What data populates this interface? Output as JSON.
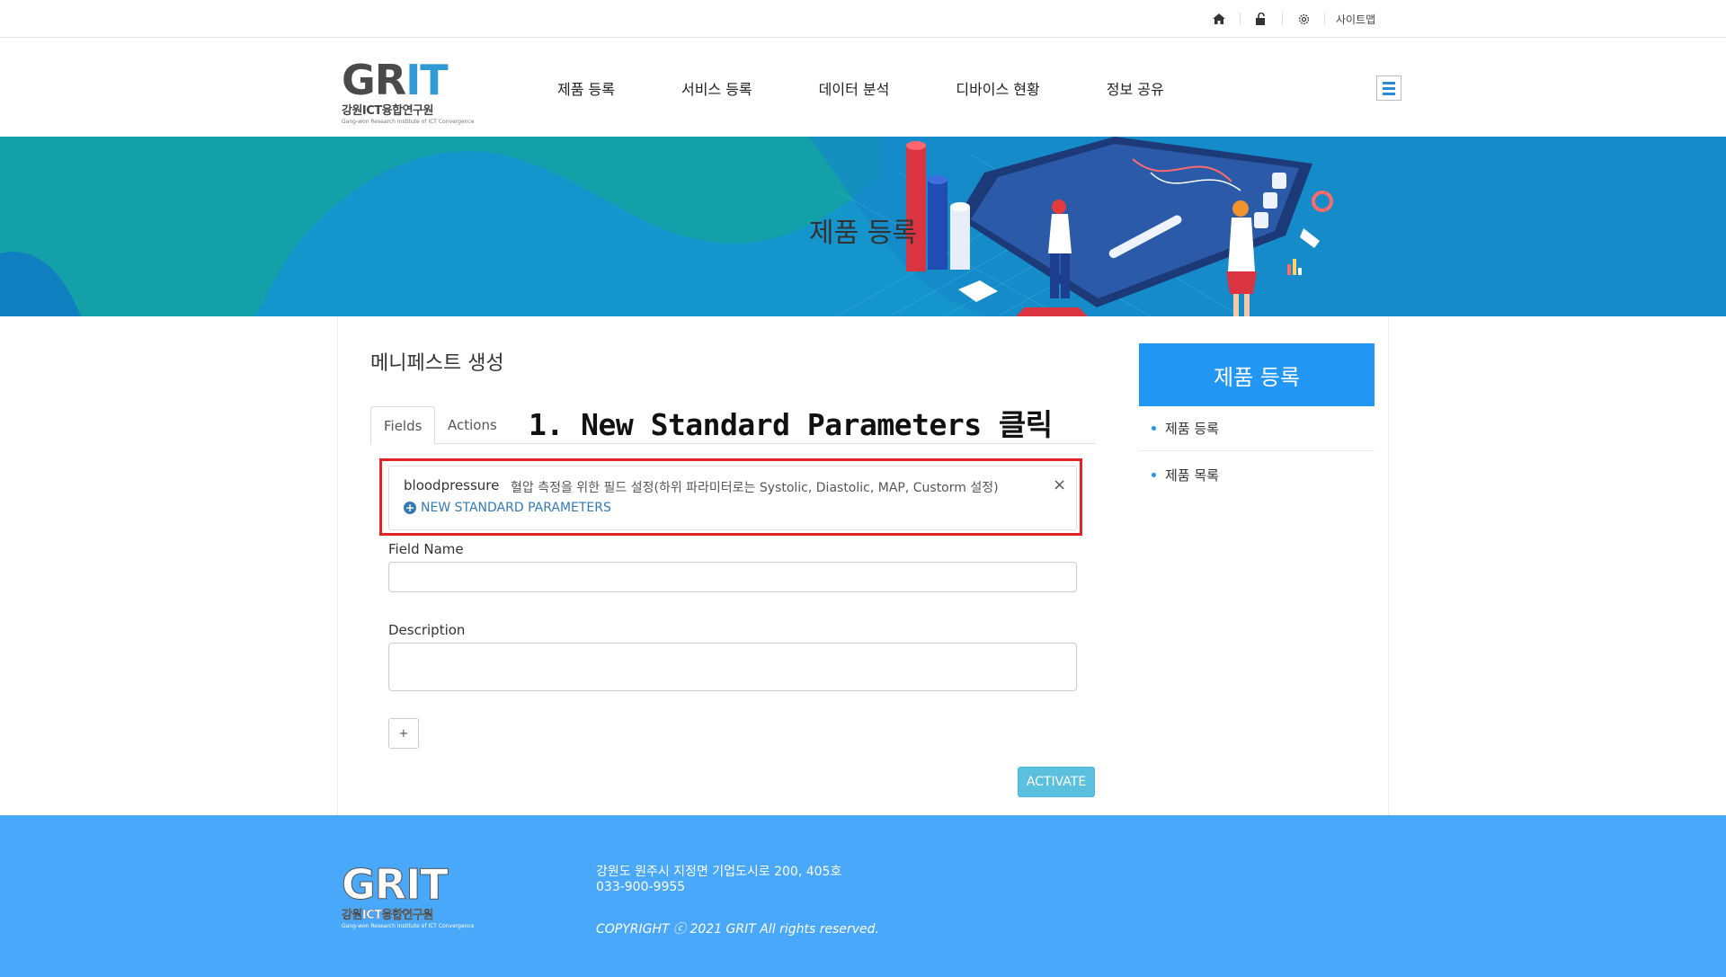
{
  "topbar": {
    "icons": [
      "home-icon",
      "unlock-icon",
      "gear-icon"
    ],
    "sitemap_label": "사이트맵"
  },
  "logo": {
    "main_left": "GR",
    "main_right": "IT",
    "sub": "강원ICT융합연구원",
    "tiny": "Gang-won Research Institute of ICT Convergence"
  },
  "gnb": {
    "items": [
      "제품 등록",
      "서비스 등록",
      "데이터 분석",
      "디바이스 현황",
      "정보 공유"
    ]
  },
  "banner": {
    "title": "제품 등록"
  },
  "main": {
    "page_title": "메니페스트 생성",
    "tabs": [
      {
        "label": "Fields",
        "active": true
      },
      {
        "label": "Actions",
        "active": false
      }
    ],
    "annotation": "1. New Standard Parameters 클릭",
    "field_card": {
      "name": "bloodpressure",
      "description": "혈압 측정을 위한 필드 설정(하위 파라미터로는 Systolic, Diastolic, MAP, Custorm 설정)",
      "close_label": "×",
      "new_std_label": "NEW STANDARD PARAMETERS"
    },
    "field_name_label": "Field Name",
    "field_name_value": "",
    "description_label": "Description",
    "description_value": "",
    "add_label": "+",
    "activate_label": "ACTIVATE"
  },
  "side": {
    "title": "제품 등록",
    "items": [
      "제품 등록",
      "제품 목록"
    ]
  },
  "footer": {
    "address": "강원도 원주시 지정면 기업도시로 200, 405호",
    "phone": "033-900-9955",
    "copyright": "COPYRIGHT ⓒ 2021 GRIT All rights reserved."
  },
  "colors": {
    "accent": "#2196f3",
    "footer_bg": "#4aa8fb",
    "highlight": "#e3222a",
    "link": "#337ab7",
    "activate": "#5bc0de"
  }
}
